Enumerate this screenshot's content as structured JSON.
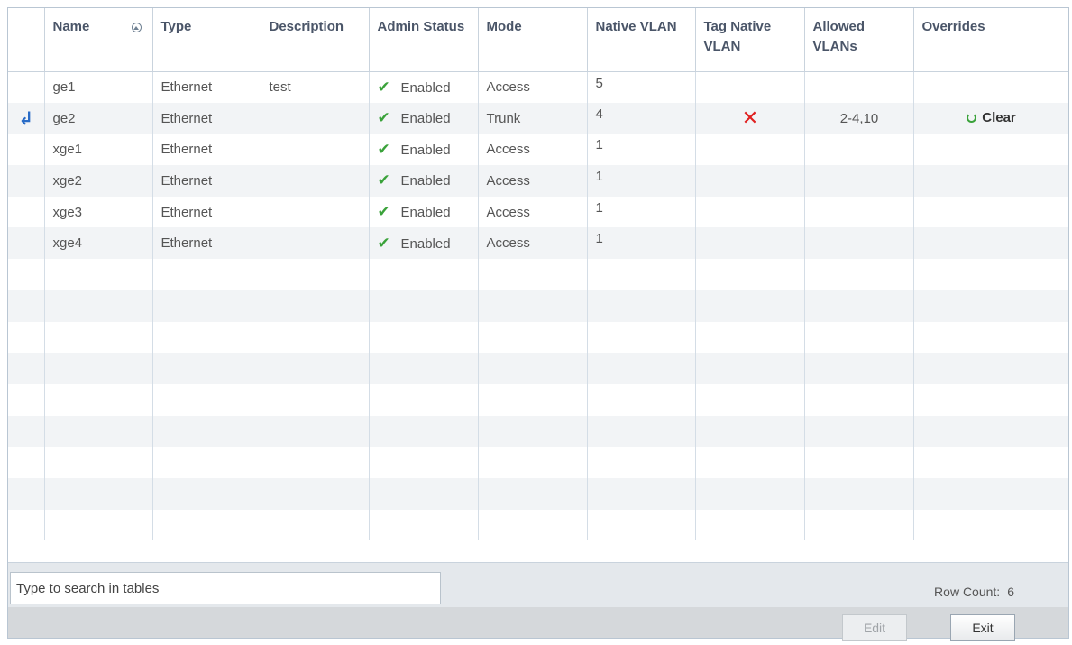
{
  "table": {
    "columns": [
      "Name",
      "Type",
      "Description",
      "Admin Status",
      "Mode",
      "Native VLAN",
      "Tag Native VLAN",
      "Allowed VLANs",
      "Overrides"
    ],
    "rows": [
      {
        "name": "ge1",
        "type": "Ethernet",
        "description": "test",
        "admin_status": "Enabled",
        "mode": "Access",
        "native_vlan": "5",
        "tag_native_vlan": "",
        "allowed_vlans": "",
        "overrides": ""
      },
      {
        "name": "ge2",
        "type": "Ethernet",
        "description": "",
        "admin_status": "Enabled",
        "mode": "Trunk",
        "native_vlan": "4",
        "tag_native_vlan": "x",
        "allowed_vlans": "2-4,10",
        "overrides": "Clear"
      },
      {
        "name": "xge1",
        "type": "Ethernet",
        "description": "",
        "admin_status": "Enabled",
        "mode": "Access",
        "native_vlan": "1",
        "tag_native_vlan": "",
        "allowed_vlans": "",
        "overrides": ""
      },
      {
        "name": "xge2",
        "type": "Ethernet",
        "description": "",
        "admin_status": "Enabled",
        "mode": "Access",
        "native_vlan": "1",
        "tag_native_vlan": "",
        "allowed_vlans": "",
        "overrides": ""
      },
      {
        "name": "xge3",
        "type": "Ethernet",
        "description": "",
        "admin_status": "Enabled",
        "mode": "Access",
        "native_vlan": "1",
        "tag_native_vlan": "",
        "allowed_vlans": "",
        "overrides": ""
      },
      {
        "name": "xge4",
        "type": "Ethernet",
        "description": "",
        "admin_status": "Enabled",
        "mode": "Access",
        "native_vlan": "1",
        "tag_native_vlan": "",
        "allowed_vlans": "",
        "overrides": ""
      }
    ],
    "selected_row_icon": "edit-arrow-icon"
  },
  "search": {
    "placeholder": "Type to search in tables"
  },
  "row_count": {
    "label": "Row Count:",
    "value": "6"
  },
  "buttons": {
    "edit": "Edit",
    "exit": "Exit"
  },
  "colors": {
    "enabled_check": "#3aa23a",
    "x_mark": "#e02020",
    "header_text": "#4a5568"
  }
}
